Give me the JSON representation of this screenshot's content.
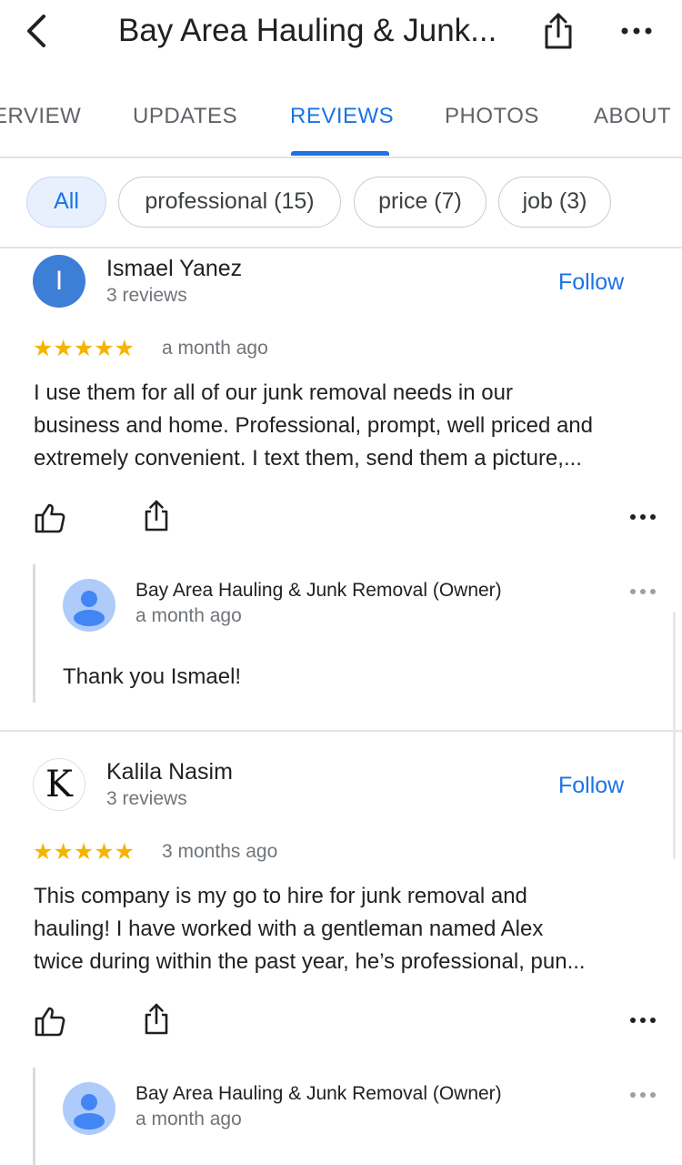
{
  "header": {
    "title": "Bay Area Hauling & Junk...",
    "back_icon": "chevron-left-icon",
    "share_icon": "share-icon",
    "more_icon": "more-horiz-icon"
  },
  "tabs": [
    {
      "label": "ERVIEW"
    },
    {
      "label": "UPDATES"
    },
    {
      "label": "REVIEWS",
      "active": true
    },
    {
      "label": "PHOTOS"
    },
    {
      "label": "ABOUT"
    }
  ],
  "chips": [
    {
      "label": "All",
      "selected": true
    },
    {
      "label": "professional (15)"
    },
    {
      "label": "price (7)"
    },
    {
      "label": "job (3)"
    }
  ],
  "reviews": [
    {
      "avatar_letter": "I",
      "name": "Ismael Yanez",
      "review_count": "3 reviews",
      "follow_label": "Follow",
      "stars": "★★★★★",
      "rating": 5,
      "date": "a month ago",
      "text_lines": [
        "I use them for all of our junk removal needs in our",
        "business and home. Professional, prompt, well priced and",
        "extremely convenient. I text them, send them a picture,..."
      ],
      "owner": {
        "name": "Bay Area Hauling & Junk Removal (Owner)",
        "date": "a month ago",
        "reply": "Thank you Ismael!"
      }
    },
    {
      "avatar_letter": "K",
      "name": "Kalila Nasim",
      "review_count": "3 reviews",
      "follow_label": "Follow",
      "stars": "★★★★★",
      "rating": 5,
      "date": "3 months ago",
      "text_lines": [
        "This company is my go to hire for junk removal and",
        "hauling! I have worked with a gentleman named Alex",
        "twice during within the past year, he’s professional, pun..."
      ],
      "owner": {
        "name": "Bay Area Hauling & Junk Removal (Owner)",
        "date": "a month ago"
      }
    }
  ],
  "colors": {
    "accent": "#1a73e8",
    "star": "#f4b400",
    "avatar_blue": "#3d7ed6"
  }
}
